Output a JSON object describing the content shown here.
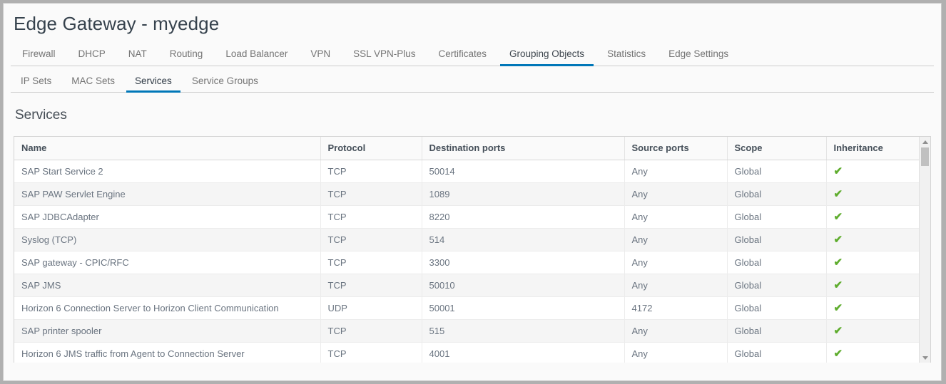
{
  "window": {
    "title": "Edge Gateway - myedge"
  },
  "tabs": [
    {
      "label": "Firewall",
      "active": false
    },
    {
      "label": "DHCP",
      "active": false
    },
    {
      "label": "NAT",
      "active": false
    },
    {
      "label": "Routing",
      "active": false
    },
    {
      "label": "Load Balancer",
      "active": false
    },
    {
      "label": "VPN",
      "active": false
    },
    {
      "label": "SSL VPN-Plus",
      "active": false
    },
    {
      "label": "Certificates",
      "active": false
    },
    {
      "label": "Grouping Objects",
      "active": true
    },
    {
      "label": "Statistics",
      "active": false
    },
    {
      "label": "Edge Settings",
      "active": false
    }
  ],
  "subtabs": [
    {
      "label": "IP Sets",
      "active": false
    },
    {
      "label": "MAC Sets",
      "active": false
    },
    {
      "label": "Services",
      "active": true
    },
    {
      "label": "Service Groups",
      "active": false
    }
  ],
  "section": {
    "title": "Services"
  },
  "table": {
    "columns": [
      "Name",
      "Protocol",
      "Destination ports",
      "Source ports",
      "Scope",
      "Inheritance"
    ],
    "rows": [
      {
        "name": "SAP Start Service 2",
        "protocol": "TCP",
        "destination_ports": "50014",
        "source_ports": "Any",
        "scope": "Global",
        "inheritance": "check-icon"
      },
      {
        "name": "SAP PAW Servlet Engine",
        "protocol": "TCP",
        "destination_ports": "1089",
        "source_ports": "Any",
        "scope": "Global",
        "inheritance": "check-icon"
      },
      {
        "name": "SAP JDBCAdapter",
        "protocol": "TCP",
        "destination_ports": "8220",
        "source_ports": "Any",
        "scope": "Global",
        "inheritance": "check-icon"
      },
      {
        "name": "Syslog (TCP)",
        "protocol": "TCP",
        "destination_ports": "514",
        "source_ports": "Any",
        "scope": "Global",
        "inheritance": "check-icon"
      },
      {
        "name": "SAP gateway - CPIC/RFC",
        "protocol": "TCP",
        "destination_ports": "3300",
        "source_ports": "Any",
        "scope": "Global",
        "inheritance": "check-icon"
      },
      {
        "name": "SAP JMS",
        "protocol": "TCP",
        "destination_ports": "50010",
        "source_ports": "Any",
        "scope": "Global",
        "inheritance": "check-icon"
      },
      {
        "name": "Horizon 6 Connection Server to Horizon Client Communication",
        "protocol": "UDP",
        "destination_ports": "50001",
        "source_ports": "4172",
        "scope": "Global",
        "inheritance": "check-icon"
      },
      {
        "name": "SAP printer spooler",
        "protocol": "TCP",
        "destination_ports": "515",
        "source_ports": "Any",
        "scope": "Global",
        "inheritance": "check-icon"
      },
      {
        "name": "Horizon 6 JMS traffic from Agent to Connection Server",
        "protocol": "TCP",
        "destination_ports": "4001",
        "source_ports": "Any",
        "scope": "Global",
        "inheritance": "check-icon"
      }
    ],
    "check_glyph": "✔"
  },
  "scrollbar": {
    "up_arrow": "scroll-up-arrow",
    "down_arrow": "scroll-down-arrow"
  },
  "colors": {
    "accent": "#0077b8",
    "check_green": "#5fad2e",
    "page_bg": "#fafafa",
    "row_alt": "#f5f5f5"
  }
}
